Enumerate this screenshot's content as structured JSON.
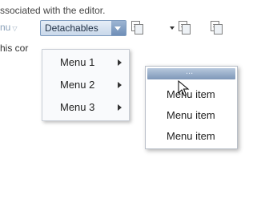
{
  "header": {
    "partial_text": "ssociated with the editor."
  },
  "menubar": {
    "menu_partial": "nu",
    "detachables_label": "Detachables",
    "toolbar_icons": [
      "copy-icon",
      "dropdown-caret",
      "copy-icon",
      "copy-icon"
    ]
  },
  "content": {
    "partial_text": "his cor"
  },
  "dropdown": {
    "items": [
      {
        "label": "Menu 1"
      },
      {
        "label": "Menu 2"
      },
      {
        "label": "Menu 3"
      }
    ]
  },
  "popup": {
    "handle_label": "...",
    "items": [
      {
        "label": "Menu item"
      },
      {
        "label": "Menu item"
      },
      {
        "label": "Menu item"
      }
    ]
  }
}
